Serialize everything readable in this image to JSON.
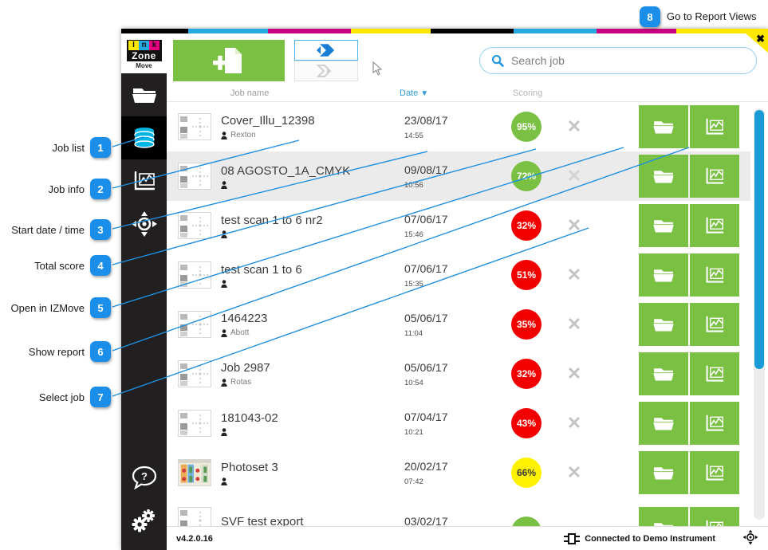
{
  "annotations": {
    "top_right": {
      "number": "8",
      "label": "Go to Report Views"
    },
    "left_items": [
      {
        "number": "1",
        "label": "Job list"
      },
      {
        "number": "2",
        "label": "Job info"
      },
      {
        "number": "3",
        "label": "Start date / time"
      },
      {
        "number": "4",
        "label": "Total score"
      },
      {
        "number": "5",
        "label": "Open in IZMove"
      },
      {
        "number": "6",
        "label": "Show report"
      },
      {
        "number": "7",
        "label": "Select job"
      }
    ]
  },
  "window": {
    "close_label": "✖",
    "cmyk_colors": [
      "#000000",
      "#26a9e0",
      "#c9027f",
      "#ffe800"
    ]
  },
  "sidebar": {
    "logo": {
      "ink_letters": [
        "I",
        "n",
        "k"
      ],
      "zone": "Zone",
      "product": "Move"
    },
    "items": [
      {
        "icon": "folder-icon",
        "name": "open-folder",
        "active": false
      },
      {
        "icon": "database-icon",
        "name": "job-list",
        "active": true
      },
      {
        "icon": "chart-icon",
        "name": "job-info",
        "active": false
      },
      {
        "icon": "target-icon",
        "name": "measure",
        "active": false
      }
    ],
    "bottom_items": [
      {
        "icon": "help-icon",
        "name": "help"
      },
      {
        "icon": "gears-icon",
        "name": "settings"
      }
    ]
  },
  "toolbar": {
    "new_job_icon": "add-document-icon",
    "view_toggle": [
      {
        "icon": "import-arrow-icon",
        "selected": true
      },
      {
        "icon": "export-arrow-icon",
        "selected": false
      }
    ],
    "search": {
      "placeholder": "Search job",
      "value": "",
      "icon": "search-icon"
    }
  },
  "columns": {
    "job_name": "Job name",
    "date": "Date",
    "date_sort_icon": "▼",
    "scoring": "Scoring"
  },
  "jobs": [
    {
      "name": "Cover_Illu_12398",
      "user": "Rexton",
      "date": "23/08/17",
      "time": "14:55",
      "score": "95%",
      "score_color": "#7ac143",
      "thumb": "layout",
      "highlighted": false
    },
    {
      "name": "08 AGOSTO_1A_CMYK",
      "user": "",
      "date": "09/08/17",
      "time": "10:56",
      "score": "72%",
      "score_color": "#7ac143",
      "thumb": "layout",
      "highlighted": true
    },
    {
      "name": "test scan 1 to 6 nr2",
      "user": "",
      "date": "07/06/17",
      "time": "15:46",
      "score": "32%",
      "score_color": "#f20000",
      "thumb": "layout",
      "highlighted": false
    },
    {
      "name": "test scan 1 to 6",
      "user": "",
      "date": "07/06/17",
      "time": "15:35",
      "score": "51%",
      "score_color": "#f20000",
      "thumb": "layout",
      "highlighted": false
    },
    {
      "name": "1464223",
      "user": "Abott",
      "date": "05/06/17",
      "time": "11:04",
      "score": "35%",
      "score_color": "#f20000",
      "thumb": "layout",
      "highlighted": false
    },
    {
      "name": "Job 2987",
      "user": "Rotas",
      "date": "05/06/17",
      "time": "10:54",
      "score": "32%",
      "score_color": "#f20000",
      "thumb": "layout",
      "highlighted": false
    },
    {
      "name": "181043-02",
      "user": "",
      "date": "07/04/17",
      "time": "10:21",
      "score": "43%",
      "score_color": "#f20000",
      "thumb": "layout",
      "highlighted": false
    },
    {
      "name": "Photoset 3",
      "user": "",
      "date": "20/02/17",
      "time": "07:42",
      "score": "66%",
      "score_color": "#fff200",
      "thumb": "photo",
      "highlighted": false
    },
    {
      "name": "SVF test export",
      "user": "",
      "date": "03/02/17",
      "time": "",
      "score": "",
      "score_color": "#7ac143",
      "thumb": "layout",
      "highlighted": false
    }
  ],
  "row_actions": {
    "delete_icon": "✕",
    "open_icon": "folder-icon",
    "report_icon": "chart-icon"
  },
  "footer": {
    "version": "v4.2.0.16",
    "connection": "Connected to Demo Instrument",
    "connection_icon": "plug-icon",
    "right_icon": "target-icon"
  },
  "scrollbar": {
    "thumb_color": "#1a9ad8",
    "track_color": "#ececec"
  }
}
